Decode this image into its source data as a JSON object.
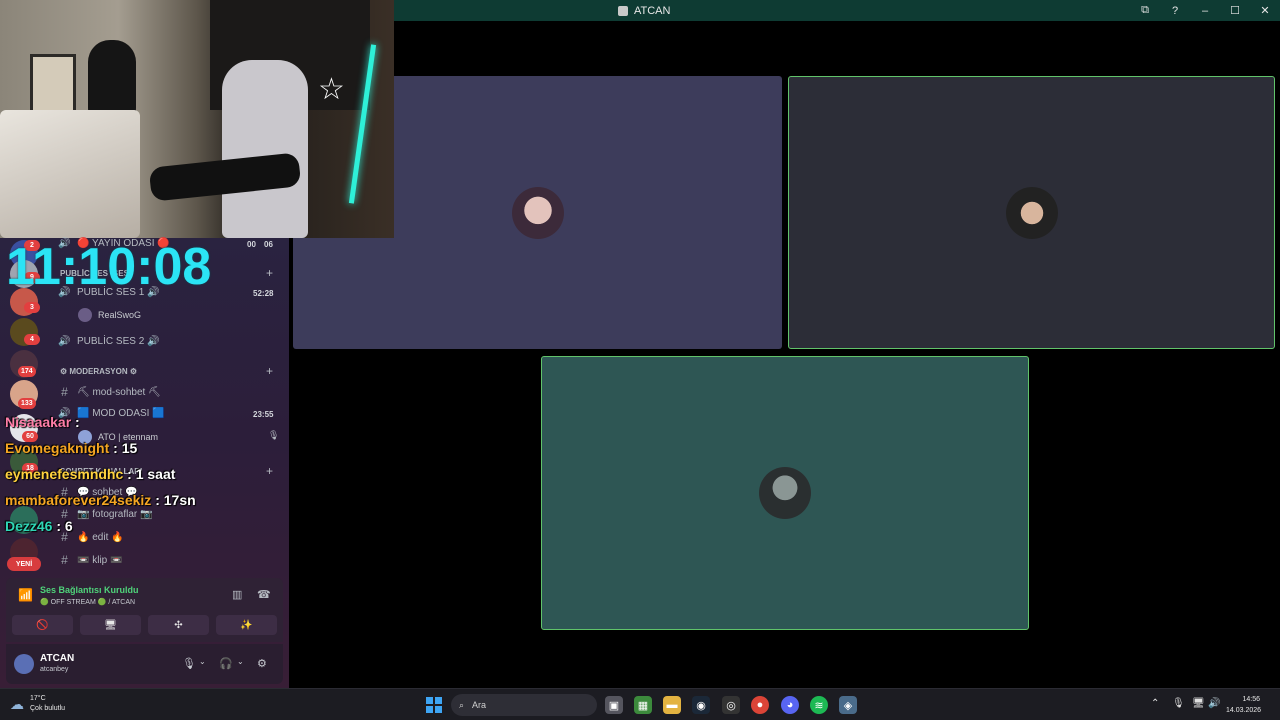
{
  "window": {
    "title": "ATCAN",
    "controls": [
      "⧉",
      "?",
      "–",
      "☐",
      "✕"
    ]
  },
  "clock_overlay": "11:10:08",
  "channels": {
    "live_channel": {
      "label": "🔴 YAYIN ODASI 🔴",
      "timer_a": "00",
      "timer_b": "06"
    },
    "public_category": "PUBLİC SES (SES)",
    "public_ses_1": {
      "label": "PUBLİC SES 1 🔊",
      "timer": "52:28",
      "member": "RealSwoG"
    },
    "public_ses_2": {
      "label": "PUBLİC SES 2 🔊"
    },
    "moderation_category": "⚙ MODERASYON ⚙",
    "mod_sohbet": "⛏ mod-sohbet ⛏",
    "mod_odasi": {
      "label": "🟦 MOD ODASI 🟦",
      "timer": "23:55",
      "member": "ATO | etennam"
    },
    "text_category": "SOHBET KANALLARI",
    "sohbet": "💬 sohbet 💬",
    "fotograflar": "📷 fotograflar 📷",
    "edit": "🔥 edit 🔥",
    "klip": "📼 klip 📼"
  },
  "server_badges": [
    "2",
    "9",
    "3",
    "4",
    "174",
    "133",
    "60",
    "18"
  ],
  "yeni_label": "YENİ",
  "chat": [
    {
      "name": "Nisaaakar",
      "message": " : ",
      "color": "#ff7ea8"
    },
    {
      "name": "Evomegaknight",
      "message": " : 15",
      "color": "#f5a623"
    },
    {
      "name": "eymenefesmndhc",
      "message": " : 1 saat",
      "color": "#ffd23f"
    },
    {
      "name": "mambaforever24sekiz",
      "message": " : 17sn",
      "color": "#f5a623"
    },
    {
      "name": "Dezz46",
      "message": " : 6",
      "color": "#2fd6b6"
    }
  ],
  "voice_panel": {
    "title": "Ses Bağlantısı Kuruldu",
    "status": "🟢 OFF STREAM 🟢 / ATCAN",
    "buttons": [
      "🚫",
      "🖥",
      "✣",
      "✨"
    ]
  },
  "user_panel": {
    "name": "ATCAN",
    "handle": "atcanbey"
  },
  "taskbar": {
    "temp": "17°C",
    "weather": "Çok bulutlu",
    "search_placeholder": "Ara",
    "time": "14:56",
    "date": "14.03.2026"
  },
  "colors": {
    "accent": "#2be4f5",
    "speaking": "#61c36a",
    "titlebar": "#0e3b33"
  }
}
